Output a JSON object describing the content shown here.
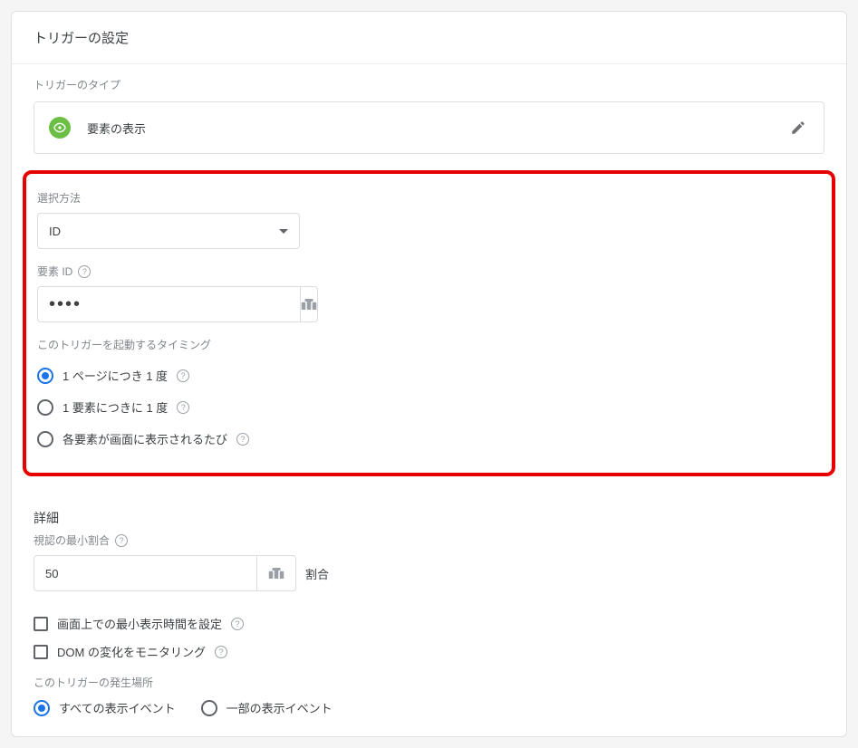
{
  "card": {
    "title": "トリガーの設定"
  },
  "trigger_type": {
    "section_label": "トリガーのタイプ",
    "type_label": "要素の表示"
  },
  "selection": {
    "method_label": "選択方法",
    "method_value": "ID",
    "element_id_label": "要素 ID",
    "element_id_value": "••••",
    "timing_label": "このトリガーを起動するタイミング",
    "timing_options": [
      {
        "label": "1 ページにつき 1 度",
        "checked": true
      },
      {
        "label": "1 要素につきに 1 度",
        "checked": false
      },
      {
        "label": "各要素が画面に表示されるたび",
        "checked": false
      }
    ]
  },
  "details": {
    "heading": "詳細",
    "min_pct_label": "視認の最小割合",
    "min_pct_value": "50",
    "pct_suffix": "割合",
    "checkbox_options": [
      {
        "label": "画面上での最小表示時間を設定",
        "checked": false
      },
      {
        "label": "DOM の変化をモニタリング",
        "checked": false
      }
    ],
    "fire_label": "このトリガーの発生場所",
    "fire_options": [
      {
        "label": "すべての表示イベント",
        "checked": true
      },
      {
        "label": "一部の表示イベント",
        "checked": false
      }
    ]
  }
}
